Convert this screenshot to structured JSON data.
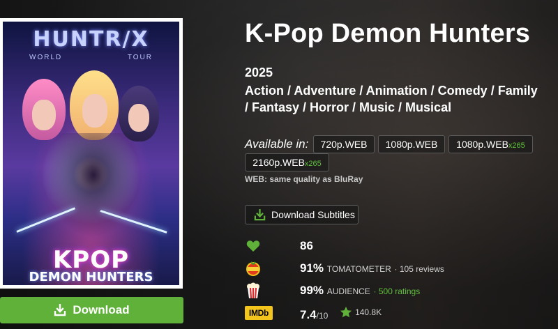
{
  "poster": {
    "brand": "HUNTR/X",
    "tour_left": "WORLD",
    "tour_right": "TOUR",
    "title_line1": "KPOP",
    "title_line2": "DEMON HUNTERS"
  },
  "download_button": {
    "label": "Download",
    "icon": "download-icon"
  },
  "movie": {
    "title": "K-Pop Demon Hunters",
    "year": "2025",
    "genres": "Action / Adventure / Animation / Comedy / Family / Fantasy / Horror / Music / Musical"
  },
  "availability": {
    "label": "Available in:",
    "qualities": [
      {
        "label": "720p.WEB",
        "codec": ""
      },
      {
        "label": "1080p.WEB",
        "codec": ""
      },
      {
        "label": "1080p.WEB",
        "codec": "x265"
      },
      {
        "label": "2160p.WEB",
        "codec": "x265"
      }
    ],
    "note": "WEB: same quality as BluRay"
  },
  "subtitles_button": {
    "label": "Download Subtitles",
    "icon": "download-icon"
  },
  "ratings": {
    "likes": {
      "icon": "heart-icon",
      "value": "86"
    },
    "tomatometer": {
      "icon": "fresh-tomato-icon",
      "value": "91%",
      "label": "TOMATOMETER",
      "reviews": "· 105 reviews"
    },
    "audience": {
      "icon": "popcorn-icon",
      "value": "99%",
      "label": "AUDIENCE",
      "ratings": "· 500 ratings"
    },
    "imdb": {
      "icon": "imdb-logo",
      "logo_text": "IMDb",
      "value": "7.4",
      "scale": "/10",
      "votes": "140.8K",
      "votes_icon": "star-icon"
    }
  },
  "colors": {
    "accent_green": "#5fb13a",
    "codec_green": "#5fc13a",
    "imdb_yellow": "#f3c41c"
  }
}
